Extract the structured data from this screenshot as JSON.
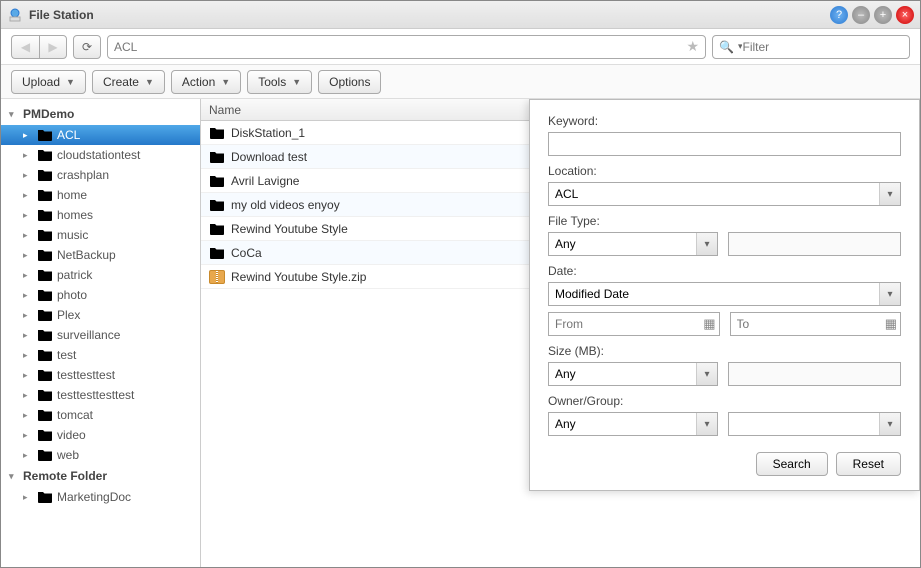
{
  "title": "File Station",
  "path": "ACL",
  "filter_placeholder": "Filter",
  "toolbar": {
    "upload": "Upload",
    "create": "Create",
    "action": "Action",
    "tools": "Tools",
    "options": "Options"
  },
  "sidebar": {
    "root1": "PMDemo",
    "items": [
      "ACL",
      "cloudstationtest",
      "crashplan",
      "home",
      "homes",
      "music",
      "NetBackup",
      "patrick",
      "photo",
      "Plex",
      "surveillance",
      "test",
      "testtesttest",
      "testtesttesttest",
      "tomcat",
      "video",
      "web"
    ],
    "root2": "Remote Folder",
    "items2": [
      "MarketingDoc"
    ]
  },
  "columns": {
    "name": "Name"
  },
  "files": [
    {
      "name": "DiskStation_1",
      "type": "folder"
    },
    {
      "name": "Download test",
      "type": "folder"
    },
    {
      "name": "Avril Lavigne",
      "type": "folder"
    },
    {
      "name": "my old videos enyoy",
      "type": "folder"
    },
    {
      "name": "Rewind Youtube Style",
      "type": "folder"
    },
    {
      "name": "CoCa",
      "type": "folder"
    },
    {
      "name": "Rewind Youtube Style.zip",
      "type": "zip"
    }
  ],
  "search": {
    "keyword_label": "Keyword:",
    "keyword_value": "",
    "location_label": "Location:",
    "location_value": "ACL",
    "filetype_label": "File Type:",
    "filetype_value": "Any",
    "date_label": "Date:",
    "date_type": "Modified Date",
    "date_from_placeholder": "From",
    "date_to_placeholder": "To",
    "size_label": "Size (MB):",
    "size_value": "Any",
    "owner_label": "Owner/Group:",
    "owner_value": "Any",
    "search_btn": "Search",
    "reset_btn": "Reset"
  }
}
